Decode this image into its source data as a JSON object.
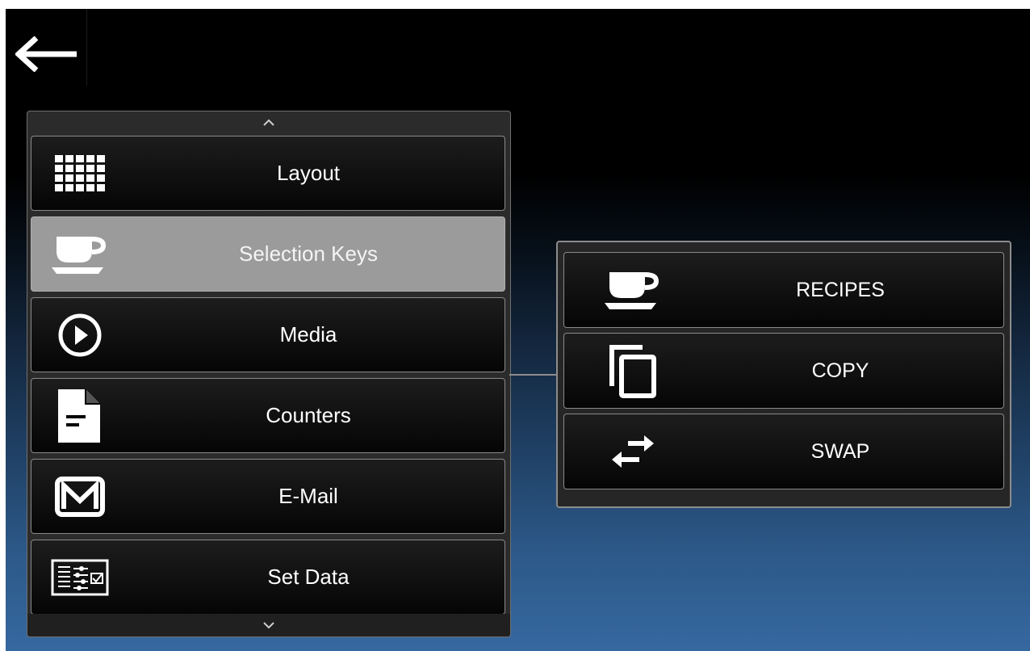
{
  "header": {
    "back_icon": "arrow-left-icon"
  },
  "menu": {
    "scroll_up_icon": "chevron-up-icon",
    "scroll_down_icon": "chevron-down-icon",
    "items": [
      {
        "label": "Layout",
        "icon": "grid-icon",
        "selected": false
      },
      {
        "label": "Selection Keys",
        "icon": "coffee-cup-icon",
        "selected": true
      },
      {
        "label": "Media",
        "icon": "play-circle-icon",
        "selected": false
      },
      {
        "label": "Counters",
        "icon": "document-icon",
        "selected": false
      },
      {
        "label": "E-Mail",
        "icon": "mail-icon",
        "selected": false
      },
      {
        "label": "Set Data",
        "icon": "settings-form-icon",
        "selected": false
      }
    ]
  },
  "submenu": {
    "items": [
      {
        "label": "RECIPES",
        "icon": "coffee-cup-icon"
      },
      {
        "label": "COPY",
        "icon": "copy-icon"
      },
      {
        "label": "SWAP",
        "icon": "swap-arrows-icon"
      }
    ]
  },
  "colors": {
    "selected_item": "#9b9b9b",
    "background_top": "#000000",
    "background_bottom": "#3668a0",
    "text": "#ffffff"
  }
}
